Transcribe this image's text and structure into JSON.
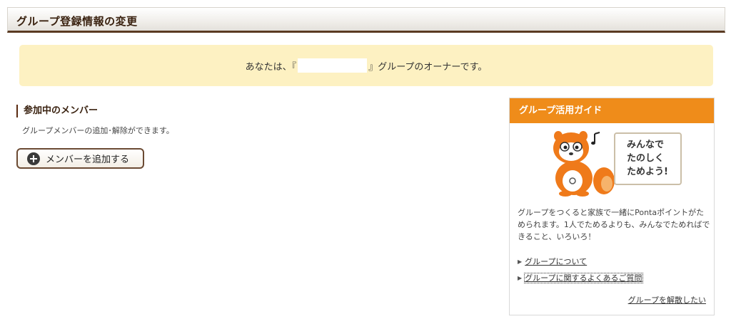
{
  "page": {
    "title": "グループ登録情報の変更"
  },
  "notice": {
    "prefix": "あなたは、『",
    "suffix": "』グループのオーナーです。"
  },
  "members": {
    "heading": "参加中のメンバー",
    "description": "グループメンバーの追加･解除ができます。",
    "add_button": "メンバーを追加する"
  },
  "guide": {
    "title": "グループ活用ガイド",
    "speech_lines": [
      "みんなで",
      "たのしく",
      "ためよう!"
    ],
    "description": "グループをつくると家族で一緒にPontaポイントがためられます。1人でためるよりも、みんなでためればできること、いろいろ！",
    "links": [
      "グループについて",
      "グループに関するよくあるご質問"
    ],
    "dissolve_link": "グループを解散したい"
  },
  "colors": {
    "accent": "#ef8c1a",
    "header_border": "#5a3a22",
    "notice_bg": "#fdf1c2"
  }
}
